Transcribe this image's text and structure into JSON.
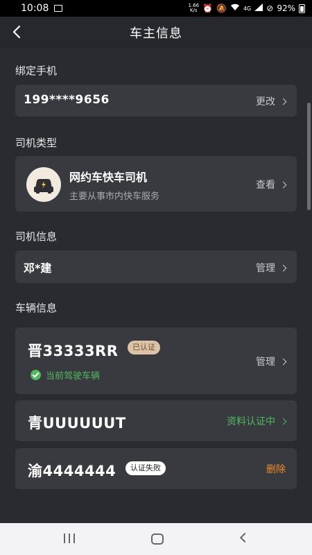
{
  "status_bar": {
    "time": "10:08",
    "network_speed_value": "1.66",
    "network_speed_unit": "K/s",
    "network_type": "4G",
    "battery": "92%"
  },
  "header": {
    "title": "车主信息"
  },
  "phone_section": {
    "label": "绑定手机",
    "number": "199****9656",
    "action": "更改"
  },
  "driver_type_section": {
    "label": "司机类型",
    "type_title": "网约车快车司机",
    "type_subtitle": "主要从事市内快车服务",
    "action": "查看"
  },
  "driver_info_section": {
    "label": "司机信息",
    "name": "邓*建",
    "action": "管理"
  },
  "vehicle_section": {
    "label": "车辆信息",
    "vehicles": [
      {
        "plate": "晋33333RR",
        "badge": "已认证",
        "current_label": "当前驾驶车辆",
        "action": "管理"
      },
      {
        "plate": "青UUUUUUT",
        "status": "资料认证中"
      },
      {
        "plate": "渝4444444",
        "badge": "认证失败",
        "action": "删除"
      }
    ]
  },
  "colors": {
    "background": "#2a2b30",
    "card": "#393a40",
    "green": "#53b85f",
    "orange": "#f08a2c",
    "certified_badge": "#dcc3a8"
  }
}
